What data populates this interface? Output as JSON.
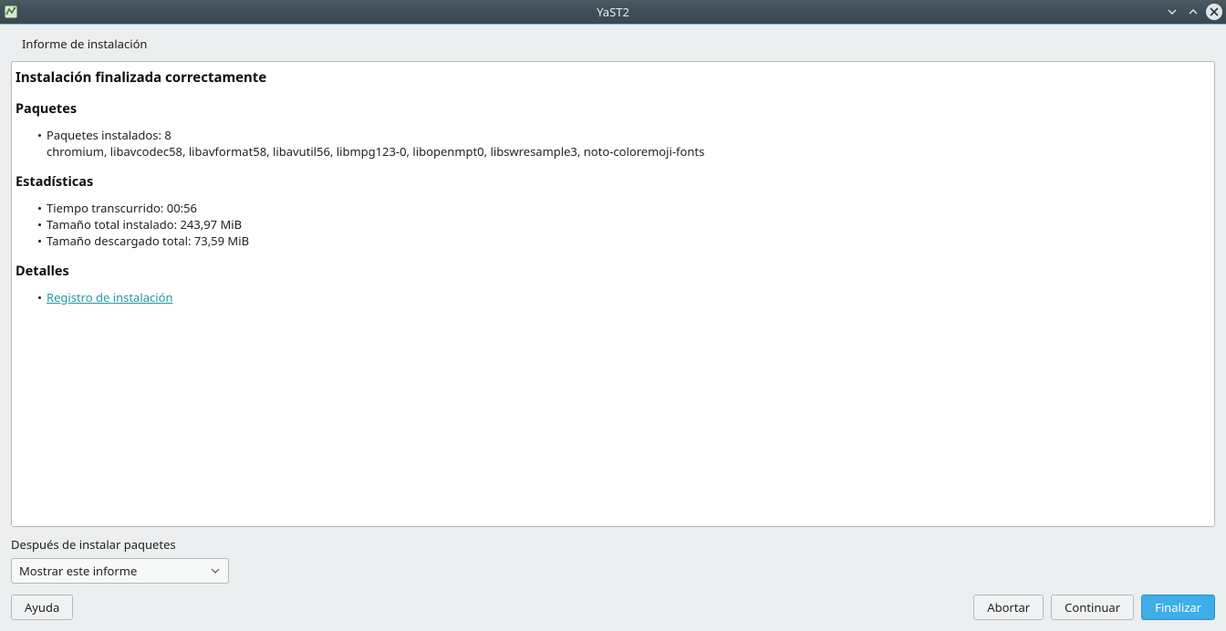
{
  "window": {
    "title": "YaST2"
  },
  "page": {
    "heading": "Informe de instalación"
  },
  "report": {
    "title": "Instalación finalizada correctamente",
    "packages": {
      "heading": "Paquetes",
      "installed_label": "Paquetes instalados: 8",
      "list": "chromium, libavcodec58, libavformat58, libavutil56, libmpg123-0, libopenmpt0, libswresample3, noto-coloremoji-fonts"
    },
    "stats": {
      "heading": "Estadísticas",
      "elapsed": "Tiempo transcurrido: 00:56",
      "installed_size": "Tamaño total instalado: 243,97 MiB",
      "downloaded_size": "Tamaño descargado total: 73,59 MiB"
    },
    "details": {
      "heading": "Detalles",
      "log_link": "Registro de instalación"
    }
  },
  "after_install": {
    "label": "Después de instalar paquetes",
    "selected": "Mostrar este informe"
  },
  "buttons": {
    "help": "Ayuda",
    "abort": "Abortar",
    "continue": "Continuar",
    "finish": "Finalizar"
  }
}
